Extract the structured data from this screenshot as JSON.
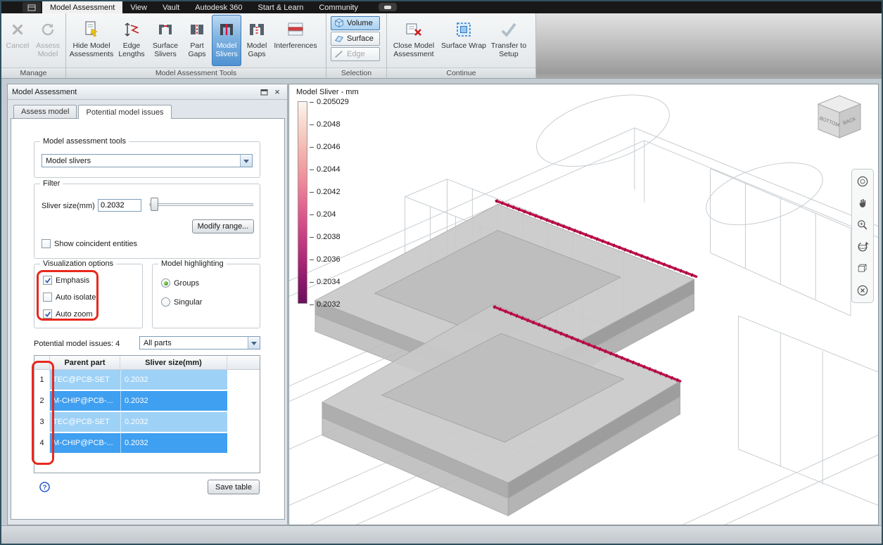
{
  "titlebar": {
    "tabs": [
      "Model Assessment",
      "View",
      "Vault",
      "Autodesk 360",
      "Start & Learn",
      "Community"
    ]
  },
  "ribbon": {
    "groups": [
      {
        "label": "Manage",
        "buttons": [
          "Cancel",
          "Assess Model"
        ]
      },
      {
        "label": "Model Assessment Tools",
        "buttons": [
          "Hide Model Assessments",
          "Edge Lengths",
          "Surface Slivers",
          "Part Gaps",
          "Model Slivers",
          "Model Gaps",
          "Interferences"
        ]
      },
      {
        "label": "Selection",
        "buttons": [
          "Volume",
          "Surface",
          "Edge"
        ]
      },
      {
        "label": "Continue",
        "buttons": [
          "Close Model Assessment",
          "Surface Wrap",
          "Transfer to Setup"
        ]
      }
    ]
  },
  "panel": {
    "title": "Model Assessment",
    "tabs": [
      "Assess model",
      "Potential model issues"
    ],
    "tools_group": {
      "label": "Model assessment tools",
      "dropdown_value": "Model slivers"
    },
    "filter_group": {
      "label": "Filter",
      "sliver_size_label": "Sliver size(mm)",
      "sliver_size_value": "0.2032",
      "modify_range_button": "Modify range...",
      "show_coincident_label": "Show coincident entities",
      "show_coincident_checked": false
    },
    "visualization_group": {
      "label": "Visualization options",
      "options": [
        {
          "label": "Emphasis",
          "checked": true
        },
        {
          "label": "Auto isolate",
          "checked": false
        },
        {
          "label": "Auto zoom",
          "checked": true
        }
      ]
    },
    "highlighting_group": {
      "label": "Model highlighting",
      "options": [
        {
          "label": "Groups",
          "selected": true
        },
        {
          "label": "Singular",
          "selected": false
        }
      ]
    },
    "issues_count_label": "Potential model issues: 4",
    "parts_filter_value": "All parts",
    "table": {
      "headers": {
        "parent": "Parent part",
        "sliver": "Sliver size(mm)"
      },
      "rows": [
        {
          "num": "1",
          "parent": "TEC@PCB-SET",
          "sliver": "0.2032"
        },
        {
          "num": "2",
          "parent": "M-CHIP@PCB-...",
          "sliver": "0.2032"
        },
        {
          "num": "3",
          "parent": "TEC@PCB-SET",
          "sliver": "0.2032"
        },
        {
          "num": "4",
          "parent": "M-CHIP@PCB-...",
          "sliver": "0.2032"
        }
      ]
    },
    "save_table_button": "Save table"
  },
  "viewport": {
    "legend": {
      "title": "Model Sliver - mm",
      "ticks": [
        "0.205029",
        "0.2048",
        "0.2046",
        "0.2044",
        "0.2042",
        "0.204",
        "0.2038",
        "0.2036",
        "0.2034",
        "0.2032"
      ]
    },
    "viewcube": {
      "face_left": "BOTTOM",
      "face_right": "BACK"
    }
  },
  "icons": {
    "help": "?",
    "close": "×"
  },
  "colors": {
    "selection_highlight": "#4a90d2",
    "sliver_red": "#c2114a",
    "table_row_light": "#9ed1f6",
    "table_row_dark": "#3f9ff0",
    "annotation_red": "#e8281e",
    "legend_top": "#fdf5f0",
    "legend_bottom": "#6a115c"
  }
}
